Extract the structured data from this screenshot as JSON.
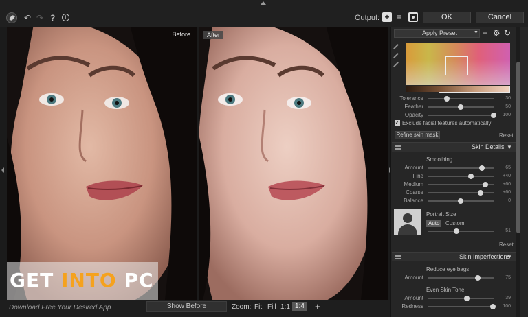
{
  "toolbar": {
    "output_label": "Output:",
    "ok_label": "OK",
    "cancel_label": "Cancel",
    "help_label": "?",
    "info_label": "i",
    "icons": [
      "leaf-logo-icon",
      "undo-icon",
      "redo-icon",
      "help-icon",
      "info-icon",
      "output-new-layer-icon",
      "output-sliders-icon",
      "output-mask-icon"
    ]
  },
  "preview": {
    "before_label": "Before",
    "after_label": "After"
  },
  "watermark": {
    "get": "GET ",
    "into": "INTO",
    "pc": " PC",
    "subtitle": "Download Free Your Desired App",
    "accent_color": "#f5a21e"
  },
  "bottombar": {
    "show_before_label": "Show Before",
    "zoom_label": "Zoom:",
    "zoom_options": [
      "Fit",
      "Fill",
      "1:1",
      "1:4"
    ],
    "zoom_selected": "1:4",
    "zoom_in": "+",
    "zoom_out": "–"
  },
  "panel": {
    "preset": {
      "selected": "Apply Preset"
    },
    "skin_mask": {
      "tolerance": {
        "label": "Tolerance",
        "value": "30",
        "level": 0.29
      },
      "feather": {
        "label": "Feather",
        "value": "50",
        "level": 0.5
      },
      "opacity": {
        "label": "Opacity",
        "value": "100",
        "level": 1.0
      },
      "exclude_label": "Exclude facial features automatically",
      "exclude_checked": true,
      "refine_label": "Refine skin mask",
      "reset_label": "Reset"
    },
    "skin_details": {
      "title": "Skin Details",
      "smoothing_title": "Smoothing",
      "sliders": [
        {
          "label": "Amount",
          "value": "65",
          "level": 0.82
        },
        {
          "label": "Fine",
          "value": "+40",
          "level": 0.66
        },
        {
          "label": "Medium",
          "value": "+60",
          "level": 0.88
        },
        {
          "label": "Coarse",
          "value": "+60",
          "level": 0.8
        },
        {
          "label": "Balance",
          "value": "0",
          "level": 0.5
        }
      ],
      "portrait_size_title": "Portrait Size",
      "auto_label": "Auto",
      "custom_label": "Custom",
      "portrait_value": "51",
      "portrait_level": 0.44,
      "reset_label": "Reset"
    },
    "skin_imperfections": {
      "title": "Skin Imperfections",
      "eye_bags_title": "Reduce eye bags",
      "eye_bags": {
        "label": "Amount",
        "value": "75",
        "level": 0.76
      },
      "even_tone_title": "Even Skin Tone",
      "even_tone_amount": {
        "label": "Amount",
        "value": "39",
        "level": 0.59
      },
      "redness": {
        "label": "Redness",
        "value": "100",
        "level": 0.99
      }
    }
  }
}
